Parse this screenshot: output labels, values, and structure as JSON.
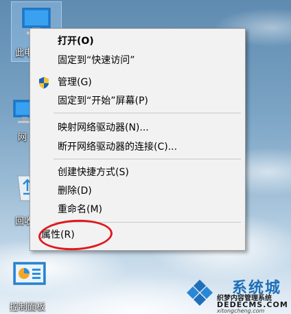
{
  "desktop": {
    "icons": [
      {
        "label": "此电",
        "icon": "this-pc-icon"
      },
      {
        "label": "网",
        "icon": "network-icon"
      },
      {
        "label": "回收",
        "icon": "recycle-bin-icon"
      },
      {
        "label": "控制面板",
        "icon": "control-panel-icon"
      }
    ]
  },
  "context_menu": {
    "items": [
      {
        "label": "打开(O)",
        "bold": true
      },
      {
        "label": "固定到“快速访问”"
      },
      {
        "label": "管理(G)",
        "icon": "uac-shield-icon"
      },
      {
        "label": "固定到“开始”屏幕(P)"
      },
      {
        "label": "映射网络驱动器(N)..."
      },
      {
        "label": "断开网络驱动器的连接(C)..."
      },
      {
        "label": "创建快捷方式(S)"
      },
      {
        "label": "删除(D)"
      },
      {
        "label": "重命名(M)"
      },
      {
        "label": "属性(R)"
      }
    ],
    "highlighted_item": "属性(R)",
    "highlight_color": "#e0181d"
  },
  "watermark": {
    "logo_text": "系统城",
    "line1": "织梦内容管理系统",
    "line2": "DEDECMS.COM",
    "line3": "xitongcheng.com",
    "color": "#1e6fb8"
  }
}
